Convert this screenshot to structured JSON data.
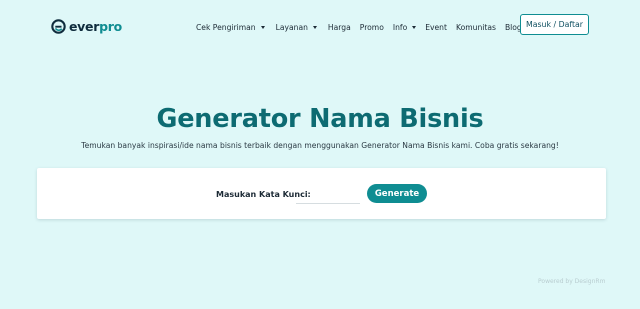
{
  "brand": {
    "name_part1": "ever",
    "name_part2": "pro",
    "icon": "everpro-logo-icon",
    "accent_color": "#0f8d92",
    "title_color": "#0d6b72",
    "background": "#dff8f8"
  },
  "nav": {
    "items": [
      {
        "label": "Cek Pengiriman",
        "has_dropdown": true
      },
      {
        "label": "Layanan",
        "has_dropdown": true
      },
      {
        "label": "Harga",
        "has_dropdown": false
      },
      {
        "label": "Promo",
        "has_dropdown": false
      },
      {
        "label": "Info",
        "has_dropdown": true
      },
      {
        "label": "Event",
        "has_dropdown": false
      },
      {
        "label": "Komunitas",
        "has_dropdown": false
      },
      {
        "label": "Blog",
        "has_dropdown": false
      }
    ],
    "login_label": "Masuk / Daftar"
  },
  "hero": {
    "title": "Generator Nama Bisnis",
    "subtitle": "Temukan banyak inspirasi/ide nama bisnis terbaik dengan menggunakan Generator Nama Bisnis kami. Coba gratis sekarang!"
  },
  "generator": {
    "keyword_label": "Masukan Kata Kunci:",
    "keyword_value": "",
    "keyword_placeholder": "",
    "button_label": "Generate"
  },
  "footer": {
    "powered_by": "Powered by DesignRm"
  }
}
